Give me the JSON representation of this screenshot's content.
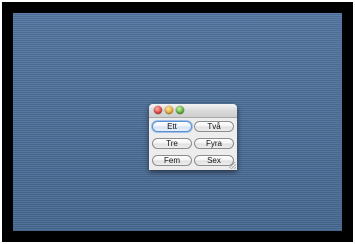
{
  "window": {
    "title": "",
    "controls": [
      "close",
      "minimize",
      "zoom"
    ],
    "buttons": [
      "Ett",
      "Två",
      "Tre",
      "Fyra",
      "Fem",
      "Sex"
    ],
    "default_button": "Ett"
  },
  "colors": {
    "desktop": "#4a6c97",
    "frame": "#000000",
    "window_bg": "#ededed",
    "close": "#e0443a",
    "minimize": "#e8a82a",
    "zoom": "#58b23a",
    "default_button_border": "#5a8fd1"
  },
  "icons": {
    "close": "close-icon",
    "minimize": "minimize-icon",
    "zoom": "zoom-icon",
    "resize": "resize-grip-icon"
  }
}
